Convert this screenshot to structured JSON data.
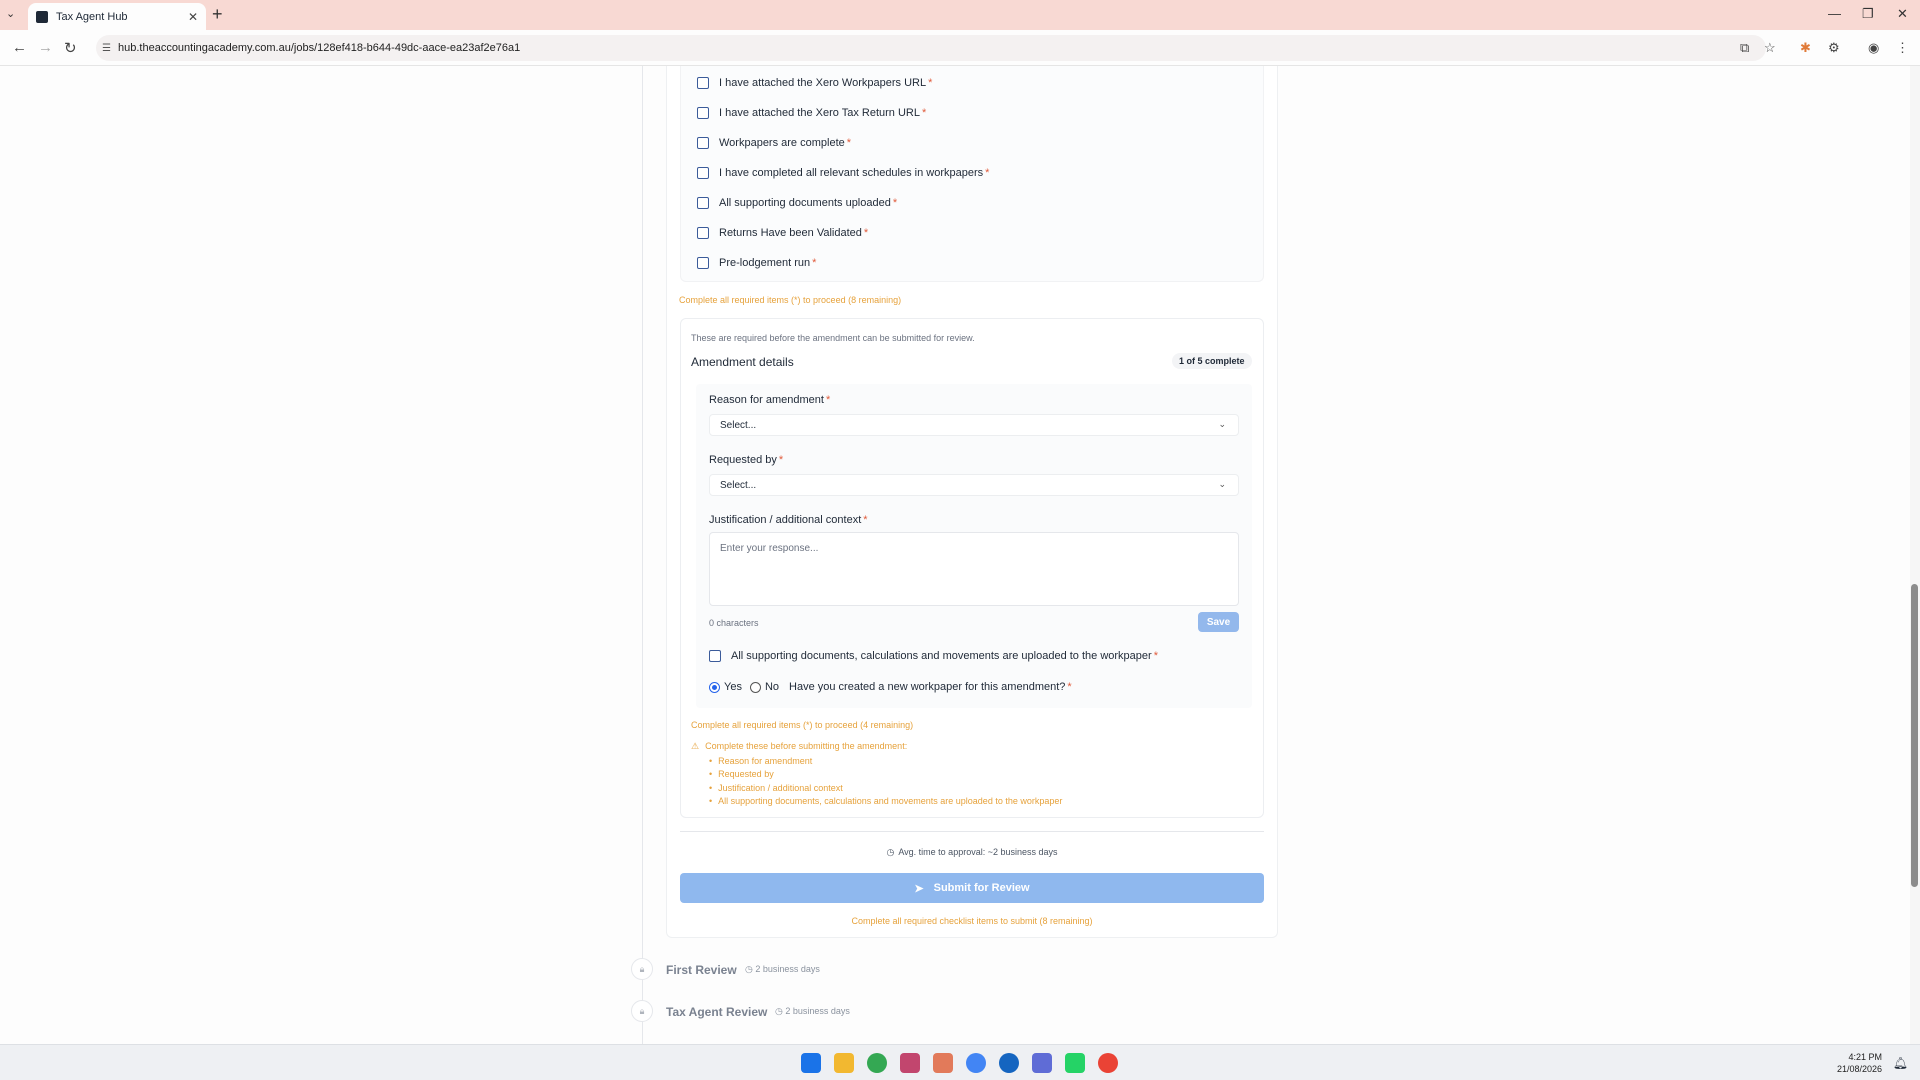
{
  "browser": {
    "tab_title": "Tax Agent Hub",
    "url": "hub.theaccountingacademy.com.au/jobs/128ef418-b644-49dc-aace-ea23af2e76a1"
  },
  "checklist": {
    "items": [
      {
        "label": "I have attached the Xero Workpapers URL",
        "required": "*"
      },
      {
        "label": "I have attached the Xero Tax Return URL",
        "required": "*"
      },
      {
        "label": "Workpapers are complete",
        "required": "*"
      },
      {
        "label": "I have completed all relevant schedules in workpapers",
        "required": "*"
      },
      {
        "label": "All supporting documents uploaded",
        "required": "*"
      },
      {
        "label": "Returns Have been Validated",
        "required": "*"
      },
      {
        "label": "Pre-lodgement run",
        "required": "*"
      }
    ],
    "warning": "Complete all required items (*) to proceed (8 remaining)"
  },
  "amendment": {
    "note": "These are required before the amendment can be submitted for review.",
    "title": "Amendment details",
    "badge": "1 of 5 complete",
    "reason_label": "Reason for amendment",
    "reason_value": "Select...",
    "requested_label": "Requested by",
    "requested_value": "Select...",
    "justification_label": "Justification / additional context",
    "justification_placeholder": "Enter your response...",
    "char_count": "0 characters",
    "save_label": "Save",
    "docs_check_label": "All supporting documents, calculations and movements are uploaded to the workpaper",
    "radio_yes": "Yes",
    "radio_no": "No",
    "radio_question": "Have you created a new workpaper for this amendment?",
    "required_mark": "*",
    "warning": "Complete all required items (*) to proceed (4 remaining)",
    "todo_title": "Complete these before submitting the amendment:",
    "todo_items": [
      "Reason for amendment",
      "Requested by",
      "Justification / additional context",
      "All supporting documents, calculations and movements are uploaded to the workpaper"
    ]
  },
  "submit": {
    "avg_time": "Avg. time to approval: ~2 business days",
    "button_label": "Submit for Review",
    "footer_warning": "Complete all required checklist items to submit (8 remaining)"
  },
  "steps": [
    {
      "title": "First Review",
      "meta": "2 business days"
    },
    {
      "title": "Tax Agent Review",
      "meta": "2 business days"
    }
  ],
  "tray": {
    "time": "4:21 PM",
    "date": "21/08/2026"
  }
}
